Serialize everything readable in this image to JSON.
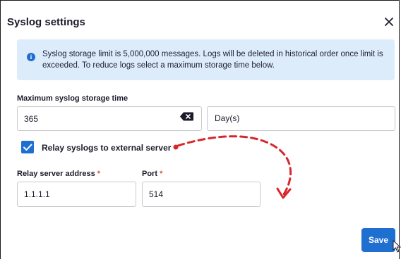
{
  "dialog": {
    "title": "Syslog settings",
    "close_icon": "close-icon"
  },
  "info": {
    "icon": "info-icon",
    "text": "Syslog storage limit is 5,000,000 messages. Logs will be deleted in historical order once limit is exceeded. To reduce logs select a maximum storage time below."
  },
  "storage": {
    "label": "Maximum syslog storage time",
    "value": "365",
    "clear_icon": "backspace-clear-icon",
    "unit": "Day(s)"
  },
  "relay": {
    "checked": true,
    "label": "Relay syslogs to external server",
    "address_label": "Relay server address",
    "address_value": "1.1.1.1",
    "port_label": "Port",
    "port_value": "514",
    "required_mark": "*"
  },
  "actions": {
    "save_label": "Save"
  },
  "colors": {
    "accent": "#1f6fd1",
    "info_bg": "#dcecfb",
    "annotation": "#d9262c",
    "required": "#e04a3e"
  }
}
